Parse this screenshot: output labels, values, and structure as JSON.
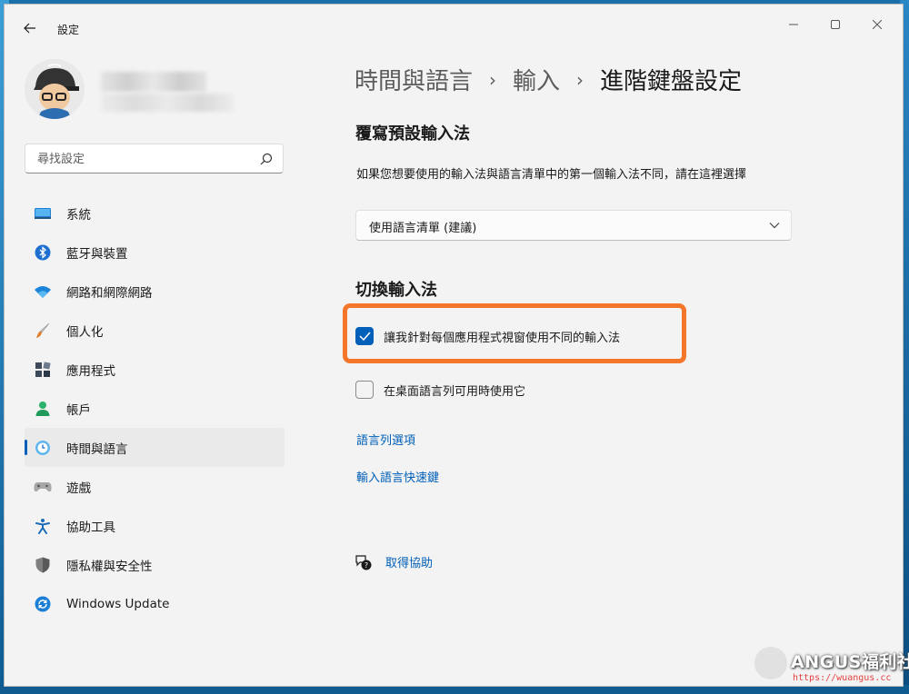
{
  "window": {
    "title": "設定"
  },
  "search": {
    "placeholder": "尋找設定"
  },
  "sidebar": {
    "items": [
      {
        "label": "系統",
        "icon": "monitor-icon"
      },
      {
        "label": "藍牙與裝置",
        "icon": "bluetooth-icon"
      },
      {
        "label": "網路和網際網路",
        "icon": "wifi-icon"
      },
      {
        "label": "個人化",
        "icon": "brush-icon"
      },
      {
        "label": "應用程式",
        "icon": "apps-icon"
      },
      {
        "label": "帳戶",
        "icon": "person-icon"
      },
      {
        "label": "時間與語言",
        "icon": "time-language-icon",
        "selected": true
      },
      {
        "label": "遊戲",
        "icon": "gamepad-icon"
      },
      {
        "label": "協助工具",
        "icon": "accessibility-icon"
      },
      {
        "label": "隱私權與安全性",
        "icon": "shield-icon"
      },
      {
        "label": "Windows Update",
        "icon": "update-icon"
      }
    ]
  },
  "breadcrumb": {
    "level1": "時間與語言",
    "level2": "輸入",
    "current": "進階鍵盤設定",
    "separator": "›"
  },
  "override": {
    "heading": "覆寫預設輸入法",
    "description": "如果您想要使用的輸入法與語言清單中的第一個輸入法不同，請在這裡選擇",
    "selected": "使用語言清單 (建議)"
  },
  "switching": {
    "heading": "切換輸入法",
    "option1": {
      "label": "讓我針對每個應用程式視窗使用不同的輸入法",
      "checked": true
    },
    "option2": {
      "label": "在桌面語言列可用時使用它",
      "checked": false
    }
  },
  "links": {
    "language_bar": "語言列選項",
    "hotkeys": "輸入語言快速鍵"
  },
  "help": {
    "label": "取得協助"
  },
  "watermark": {
    "brand": "ANGUS福利社",
    "url": "https://wuangus.cc"
  },
  "colors": {
    "accent": "#005fb8",
    "highlight": "#f4762a",
    "background": "#f3f3f3"
  }
}
